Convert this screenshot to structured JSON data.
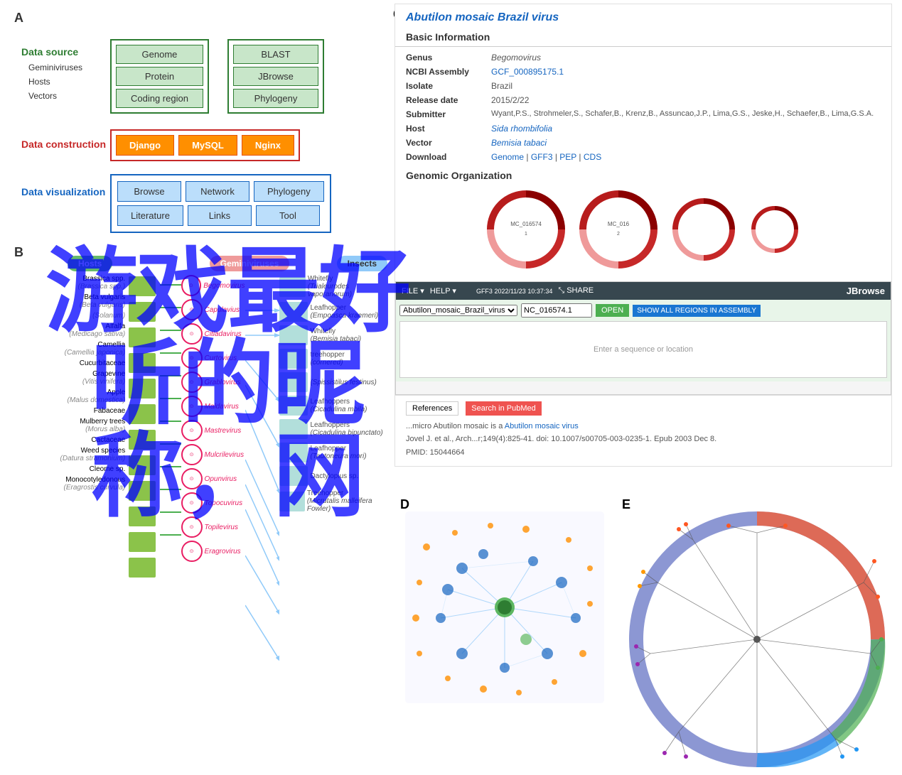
{
  "panel_a": {
    "label": "A",
    "data_source": {
      "label": "Data source",
      "items": [
        "Geminiviruses",
        "Hosts",
        "Vectors"
      ]
    },
    "green_group1": {
      "items": [
        "Genome",
        "Protein",
        "Coding region"
      ]
    },
    "green_group2": {
      "items": [
        "BLAST",
        "JBrowse",
        "Phylogeny"
      ]
    },
    "data_construction": {
      "label": "Data construction",
      "items": [
        "Django",
        "MySQL",
        "Nginx"
      ]
    },
    "data_visualization": {
      "label": "Data visualization",
      "row1": [
        "Browse",
        "Network",
        "Phylogeny"
      ],
      "row2": [
        "Literature",
        "Links",
        "Tool"
      ]
    }
  },
  "panel_b": {
    "label": "B",
    "headers": [
      "Hosts",
      "Geminiviruses",
      "Insects"
    ],
    "hosts": [
      {
        "name": "Brassica spp.",
        "italic": "(Brassica spp.)"
      },
      {
        "name": "Beta vulgaris",
        "italic": "(Beta vulgaris)"
      },
      {
        "name": "Solanum",
        "italic": "(Solanum)"
      },
      {
        "name": "Alfalfa",
        "italic": "(Medicago sativa)"
      },
      {
        "name": "Camellia",
        "italic": "(Camellia japonica)"
      },
      {
        "name": "Cucurbitaceae",
        "italic": ""
      },
      {
        "name": "Grapevine",
        "italic": "(Vitis vinifera)"
      },
      {
        "name": "Apple",
        "italic": "(Malus domestica)"
      },
      {
        "name": "Fabaceae",
        "italic": ""
      },
      {
        "name": "Mulberry trees",
        "italic": "(Morus alba)"
      },
      {
        "name": "Cactaceae",
        "italic": ""
      },
      {
        "name": "Weed species",
        "italic": "(Datura stramonium)"
      },
      {
        "name": "Cleome sp.",
        "italic": ""
      },
      {
        "name": "Monocotyledonous",
        "italic": "(Eragrostis curvula)"
      }
    ],
    "geminis": [
      "Begomovirus",
      "Capulavius",
      "Citladavirus",
      "Curtovirus",
      "Grablovirus",
      "Maldavirus",
      "Mastrevirus",
      "Mulcrilevirus",
      "Opunvirus",
      "Topocuvirus",
      "Topilevirus",
      "Eragrovirus"
    ],
    "insects": [
      "Whitefly (Trialeurodes vaporariorum)",
      "Leafhopper (Empoasca kraemeri)",
      "Whitefly (Bemisia tabaci)",
      "Treehopper (cornered treehopper)",
      "Leafhopper (Spissistilus festinus)",
      "Leafhoppers (Cicadulina mbila)",
      "Leafhoppers (Cicadulina bipunctato)",
      "Leafhopper (Tautoneura mori)",
      "Dactylopius sp.",
      "Treehopper (Micrutalis malleifera Fowler)"
    ]
  },
  "panel_c": {
    "label": "C",
    "virus_title": "Abutilon mosaic Brazil virus",
    "basic_info_title": "Basic Information",
    "fields": [
      {
        "label": "Genus",
        "value": "Begomovirus"
      },
      {
        "label": "NCBI Assembly",
        "value": "GCF_000895175.1",
        "link": true
      },
      {
        "label": "Isolate",
        "value": "Brazil"
      },
      {
        "label": "Release date",
        "value": "2015/2/22"
      },
      {
        "label": "Submitter",
        "value": "Wyant,P.S., Strohmeler,S., Schafer,B., Krenz,B., Assuncao,J.P., Lima,G.S., Jeske,H., Schaefer,B., Lima,G.S.A."
      },
      {
        "label": "Host",
        "value": "Sida rhombifolia",
        "link": true
      },
      {
        "label": "Vector",
        "value": "Bemisia tabaci",
        "link": true
      },
      {
        "label": "Download",
        "value": "Genome | GFF3 | PEP | CDS",
        "link": true
      }
    ],
    "genomic_title": "Genomic Organization"
  },
  "panel_d": {
    "label": "D"
  },
  "panel_e": {
    "label": "E"
  },
  "watermark": {
    "text": "游戏最好听的昵称，网"
  }
}
